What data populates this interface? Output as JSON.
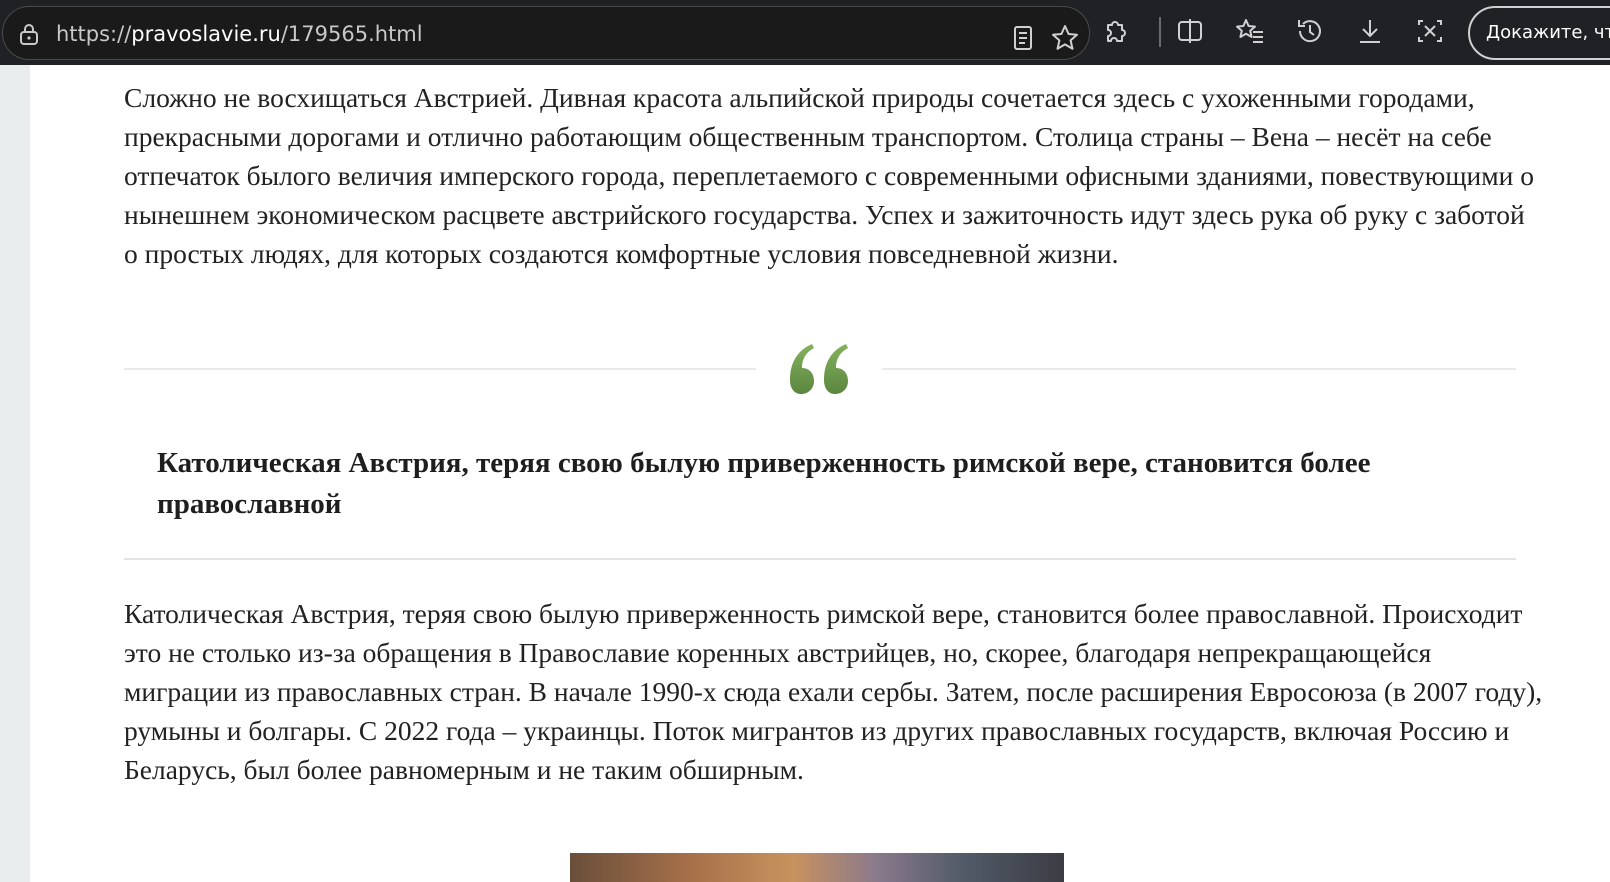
{
  "browser": {
    "url_scheme": "https://",
    "url_host": "pravoslavie.ru",
    "url_path": "/179565.html",
    "captcha_button_label": "Докажите, что"
  },
  "article": {
    "paragraph_1": "Сложно не восхищаться Австрией. Дивная красота альпийской природы сочетается здесь с ухоженными городами, прекрасными дорогами и отлично работающим общественным транспортом. Столица страны – Вена – несёт на себе отпечаток былого величия имперского города, переплетаемого с современными офисными зданиями, повествующими о нынешнем экономическом расцвете австрийского государства. Успех и зажиточность идут здесь рука об руку с заботой о простых людях, для которых создаются комфортные условия повседневной жизни.",
    "pullquote": "Католическая Австрия, теряя свою былую приверженность римской вере, становится более православной",
    "paragraph_2": "Католическая Австрия, теряя свою былую приверженность римской вере, становится более православной. Происходит это не столько из-за обращения в Православие коренных австрийцев, но, скорее, благодаря непрекращающейся миграции из православных стран. В начале 1990-х сюда ехали сербы. Затем, после расширения Евросоюза (в 2007 году), румыны и болгары. С 2022 года – украинцы. Поток мигрантов из других православных государств, включая Россию и Беларусь, был более равномерным и не таким обширным."
  },
  "icons": {
    "address_bar": [
      "lock-icon"
    ],
    "toolbar": [
      "reader-view-icon",
      "favorite-star-icon",
      "extensions-icon",
      "split-screen-icon",
      "favorites-icon",
      "history-icon",
      "downloads-icon",
      "screenshot-icon"
    ],
    "article": [
      "quote-mark-icon"
    ]
  },
  "colors": {
    "toolbar_bg": "#202124",
    "quote_mark_green": "#6e9a4a",
    "text": "#222222"
  }
}
